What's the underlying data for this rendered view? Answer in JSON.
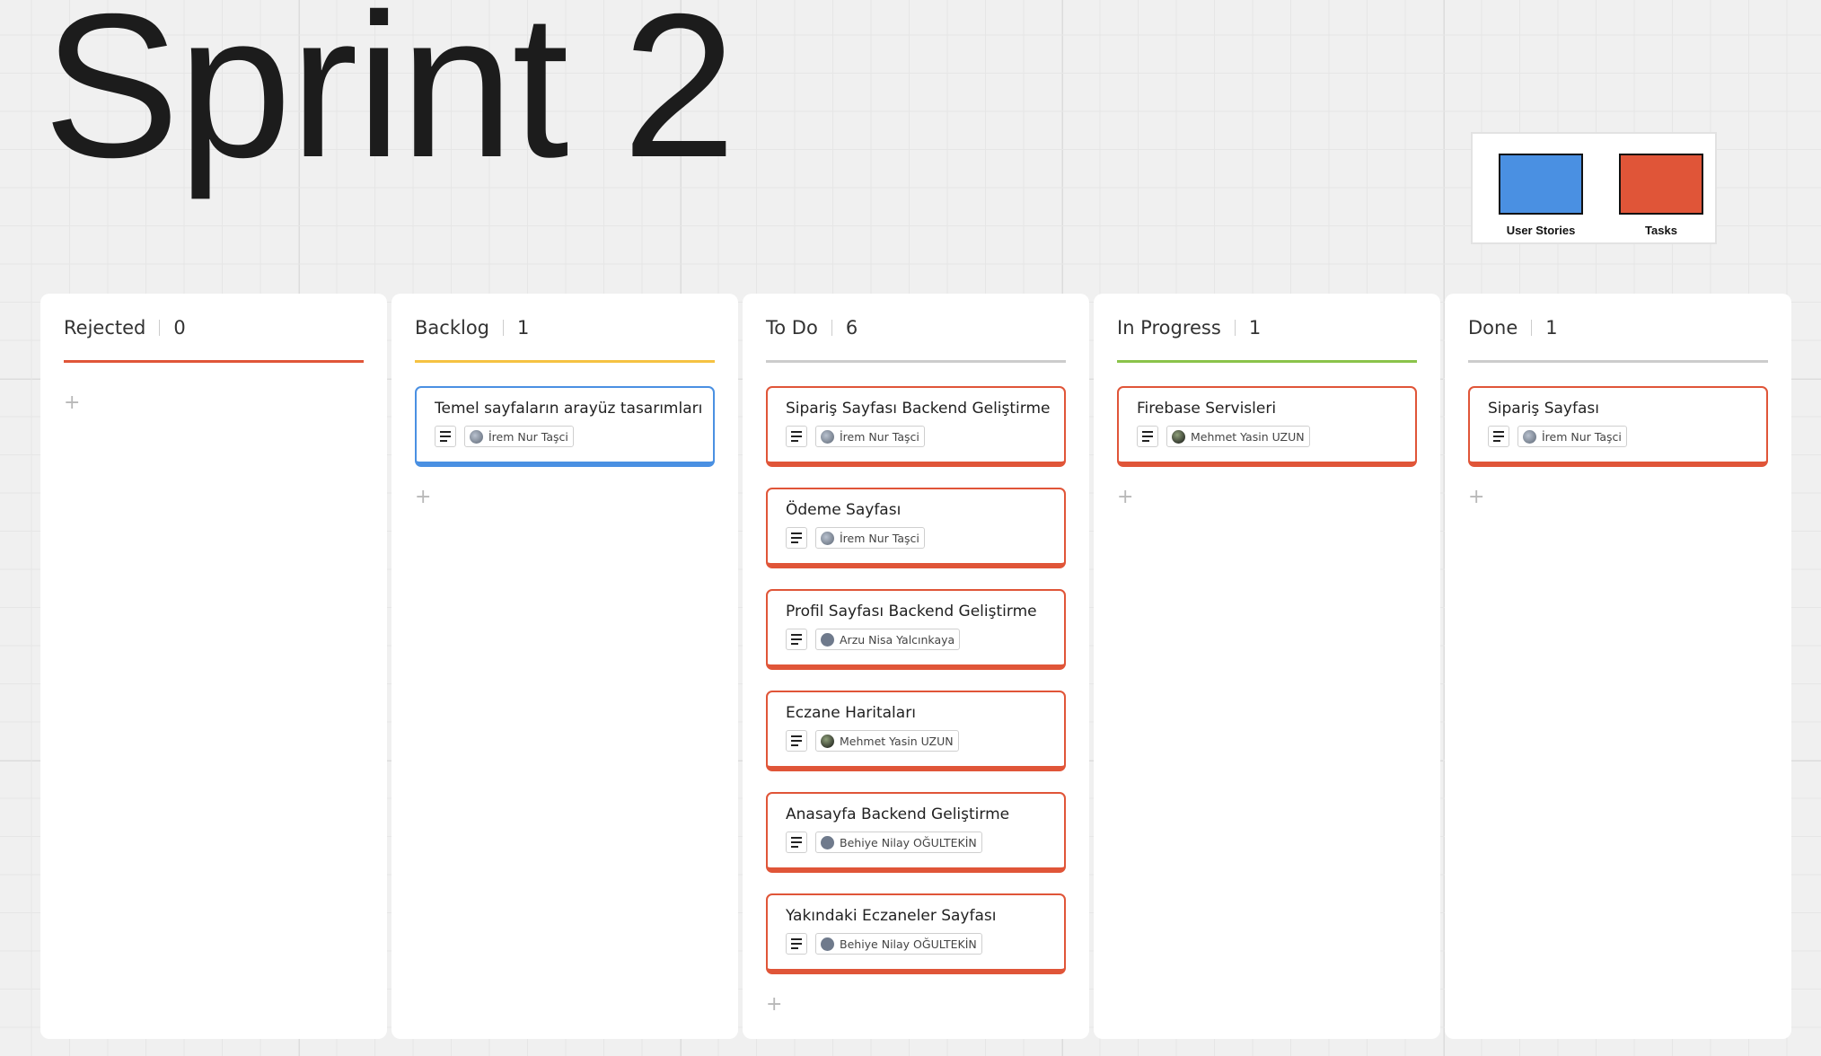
{
  "board_title": "Sprint 2",
  "legend": {
    "items": [
      {
        "label": "User Stories",
        "color": "#4a90e2"
      },
      {
        "label": "Tasks",
        "color": "#e05538"
      }
    ]
  },
  "columns": [
    {
      "name": "Rejected",
      "count": "0",
      "accent": "#e05538",
      "cards": []
    },
    {
      "name": "Backlog",
      "count": "1",
      "accent": "#f5c242",
      "cards": [
        {
          "title": "Temel sayfaların arayüz tasarımları",
          "assignee": "İrem Nur Taşci",
          "type": "user-story"
        }
      ]
    },
    {
      "name": "To Do",
      "count": "6",
      "accent": "#cccccc",
      "cards": [
        {
          "title": "Sipariş Sayfası Backend Geliştirme",
          "assignee": "İrem Nur Taşci",
          "type": "task"
        },
        {
          "title": "Ödeme Sayfası",
          "assignee": "İrem Nur Taşci",
          "type": "task"
        },
        {
          "title": "Profil Sayfası Backend Geliştirme",
          "assignee": "Arzu Nisa Yalcınkaya",
          "type": "task"
        },
        {
          "title": "Eczane Haritaları",
          "assignee": "Mehmet Yasin UZUN",
          "type": "task"
        },
        {
          "title": "Anasayfa Backend Geliştirme",
          "assignee": "Behiye Nilay OĞULTEKİN",
          "type": "task"
        },
        {
          "title": "Yakındaki Eczaneler Sayfası",
          "assignee": "Behiye Nilay OĞULTEKİN",
          "type": "task"
        }
      ]
    },
    {
      "name": "In Progress",
      "count": "1",
      "accent": "#8bc34a",
      "cards": [
        {
          "title": "Firebase Servisleri",
          "assignee": "Mehmet Yasin UZUN",
          "type": "task"
        }
      ]
    },
    {
      "name": "Done",
      "count": "1",
      "accent": "#cccccc",
      "cards": [
        {
          "title": "Sipariş Sayfası",
          "assignee": "İrem Nur Taşci",
          "type": "task"
        }
      ]
    }
  ],
  "icons": {
    "add": "+",
    "description": "description-icon"
  }
}
